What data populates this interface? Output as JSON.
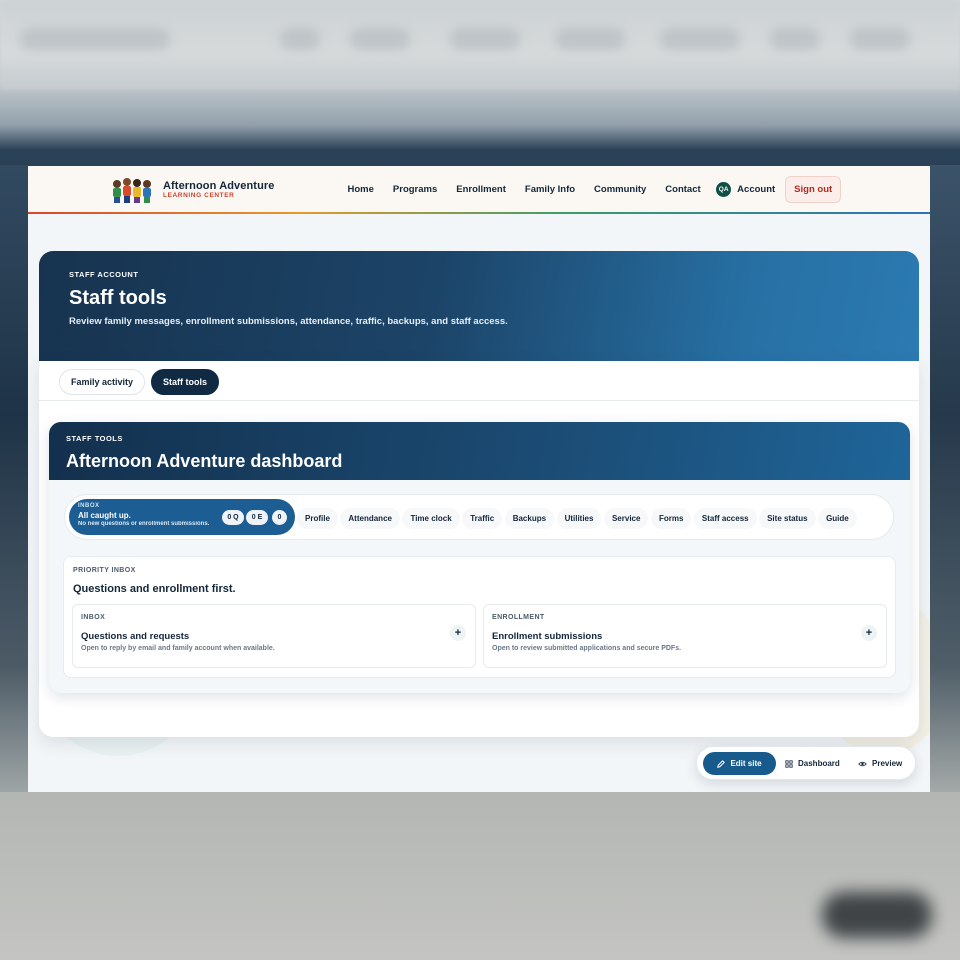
{
  "header": {
    "brand_name": "Afternoon Adventure",
    "brand_sub": "LEARNING CENTER",
    "nav": [
      "Home",
      "Programs",
      "Enrollment",
      "Family Info",
      "Community",
      "Contact"
    ],
    "account_initials": "QA",
    "account_label": "Account",
    "signout_label": "Sign out"
  },
  "hero": {
    "kicker": "STAFF ACCOUNT",
    "title": "Staff tools",
    "description": "Review family messages, enrollment submissions, attendance, traffic, backups, and staff access."
  },
  "tabs": [
    {
      "label": "Family activity",
      "active": false
    },
    {
      "label": "Staff tools",
      "active": true
    }
  ],
  "dashboard": {
    "kicker": "STAFF TOOLS",
    "title": "Afternoon Adventure dashboard",
    "inbox": {
      "kicker": "INBOX",
      "title": "All caught up.",
      "subtitle": "No new questions or enrollment submissions.",
      "chip_questions": "0 Q",
      "chip_enrollment": "0 E",
      "chip_other": "0"
    },
    "tools": [
      "Profile",
      "Attendance",
      "Time clock",
      "Traffic",
      "Backups",
      "Utilities",
      "Service",
      "Forms",
      "Staff access",
      "Site status",
      "Guide"
    ],
    "priority": {
      "kicker": "PRIORITY INBOX",
      "title": "Questions and enrollment first.",
      "boxes": [
        {
          "kicker": "INBOX",
          "title": "Questions and requests",
          "subtitle": "Open to reply by email and family account when available."
        },
        {
          "kicker": "ENROLLMENT",
          "title": "Enrollment submissions",
          "subtitle": "Open to review submitted applications and secure PDFs."
        }
      ]
    }
  },
  "editbar": {
    "edit_label": "Edit site",
    "dashboard_label": "Dashboard",
    "preview_label": "Preview"
  },
  "colors": {
    "navy": "#102a44",
    "accent_blue": "#1c5d93",
    "signout_red": "#b42b20"
  }
}
